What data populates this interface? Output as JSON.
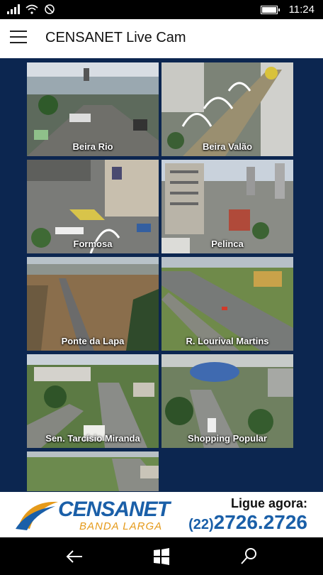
{
  "status_bar": {
    "time": "11:24",
    "icons": [
      "signal-icon",
      "wifi-icon",
      "do-not-disturb-icon",
      "battery-icon"
    ]
  },
  "header": {
    "menu_icon": "hamburger-icon",
    "title": "CENSANET Live Cam"
  },
  "cameras": [
    {
      "label": "Beira Rio"
    },
    {
      "label": "Beira Valão"
    },
    {
      "label": "Formosa"
    },
    {
      "label": "Pelinca"
    },
    {
      "label": "Ponte da Lapa"
    },
    {
      "label": "R. Lourival Martins"
    },
    {
      "label": "Sen. Tarcísio Miranda"
    },
    {
      "label": "Shopping Popular"
    },
    {
      "label": ""
    }
  ],
  "ad": {
    "brand": "CENSANET",
    "tagline": "BANDA LARGA",
    "cta": "Ligue agora:",
    "phone_area": "(22)",
    "phone_number": "2726.2726",
    "colors": {
      "brand_blue": "#1a5fa8",
      "accent_orange": "#e59a1a"
    }
  },
  "nav_bar": {
    "buttons": [
      "back-icon",
      "windows-start-icon",
      "search-icon"
    ]
  },
  "colors": {
    "content_bg": "#0c2650",
    "header_bg": "#ffffff",
    "system_bar": "#000000"
  }
}
